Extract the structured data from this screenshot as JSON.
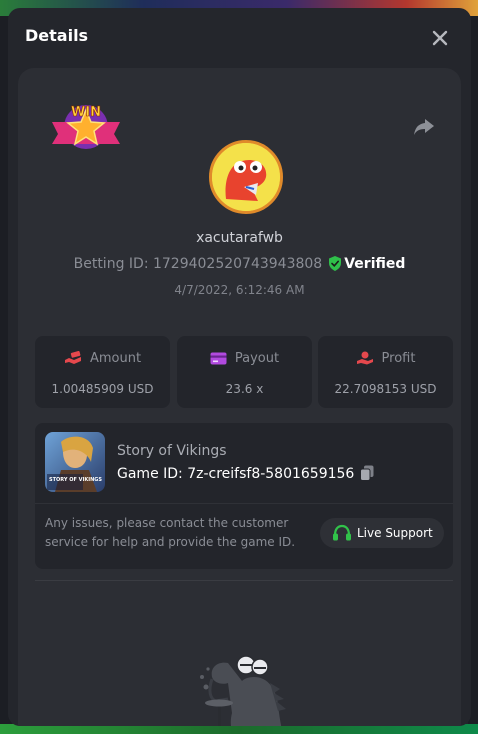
{
  "modal": {
    "title": "Details",
    "close_icon": "close-icon"
  },
  "bet": {
    "badge": "WIN",
    "username": "xacutarafwb",
    "betting_id_label": "Betting ID: 1729402520743943808",
    "verified_label": "Verified",
    "date": "4/7/2022, 6:12:46 AM"
  },
  "stats": [
    {
      "label": "Amount",
      "value": "1.00485909 USD",
      "icon": "money-hand-icon"
    },
    {
      "label": "Payout",
      "value": "23.6 x",
      "icon": "card-icon"
    },
    {
      "label": "Profit",
      "value": "22.7098153 USD",
      "icon": "profit-hand-icon"
    }
  ],
  "game": {
    "thumb_text": "STORY OF VIKINGS",
    "name": "Story of Vikings",
    "id_label": "Game ID: 7z-creifsf8-5801659156",
    "help_text": "Any issues, please contact the customer service for help and provide the game ID.",
    "support_label": "Live Support"
  },
  "colors": {
    "accent_red": "#e5484d",
    "payout_purple": "#b14adf",
    "verified_green": "#2fbf4a",
    "support_green": "#31c24a"
  }
}
